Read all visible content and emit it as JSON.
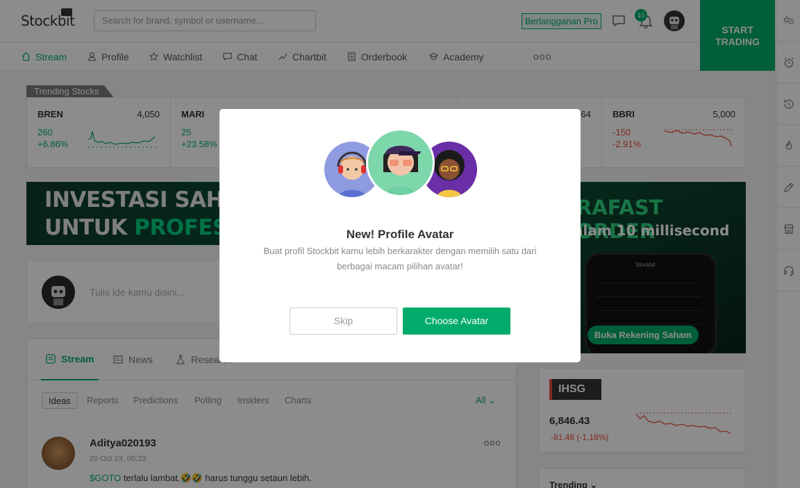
{
  "header": {
    "logo": "Stockbit",
    "search_placeholder": "Search for brand, symbol or username...",
    "pro_label": "Berlangganan Pro",
    "notification_count": "10",
    "start_trading_line1": "START",
    "start_trading_line2": "TRADING"
  },
  "nav": {
    "items": [
      {
        "label": "Stream",
        "icon": "home-icon"
      },
      {
        "label": "Profile",
        "icon": "person-icon"
      },
      {
        "label": "Watchlist",
        "icon": "star-icon"
      },
      {
        "label": "Chat",
        "icon": "chat-icon"
      },
      {
        "label": "Chartbit",
        "icon": "chart-icon"
      },
      {
        "label": "Orderbook",
        "icon": "orderbook-icon"
      },
      {
        "label": "Academy",
        "icon": "academy-icon"
      }
    ],
    "more": "ooo"
  },
  "trending": {
    "title": "Trending Stocks",
    "stocks": [
      {
        "symbol": "BREN",
        "price": "4,050",
        "change": "260",
        "percent": "+6.86%",
        "direction": "up"
      },
      {
        "symbol": "MARI",
        "price": "",
        "change": "25",
        "percent": "+23.58%",
        "direction": "up"
      },
      {
        "symbol": "",
        "price": "",
        "change": "",
        "percent": "",
        "direction": "up"
      },
      {
        "symbol": "",
        "price": "64",
        "change": "",
        "percent": "",
        "direction": "up"
      },
      {
        "symbol": "BBRI",
        "price": "5,000",
        "change": "-150",
        "percent": "-2.91%",
        "direction": "down"
      }
    ]
  },
  "banner": {
    "line1": "INVESTASI SAHA",
    "line2_a": "UNTUK ",
    "line2_b": "PROFESIO",
    "right_title": "RAFAST ORDER",
    "right_subtitle": "alam 10 millisecond",
    "phone_brand": "Stockbit",
    "cta": "Buka Rekening Saham"
  },
  "composer": {
    "placeholder": "Tulis ide kamu disini..."
  },
  "feed": {
    "tabs": [
      {
        "label": "Stream",
        "icon": "stream-icon"
      },
      {
        "label": "News",
        "icon": "news-icon"
      },
      {
        "label": "Research",
        "icon": "flask-icon"
      }
    ],
    "filters": [
      "Ideas",
      "Reports",
      "Predictions",
      "Polling",
      "Insiders",
      "Charts"
    ],
    "filter_all": "All",
    "post": {
      "user": "Aditya020193",
      "time": "20 Oct 23, 00:23",
      "ticker": "$GOTO",
      "text": " terlalu lambat.🤣🤣 harus tunggu setaun lebih.",
      "more": "ooo"
    }
  },
  "ihsg": {
    "label": "IHSG",
    "value": "6,846.43",
    "change": "-81.48 (-1.18%)"
  },
  "trending_card": {
    "title": "Trending"
  },
  "modal": {
    "title": "New! Profile Avatar",
    "description": "Buat profil Stockbit kamu lebih berkarakter dengan memilih satu dari berbagai macam pilihan avatar!",
    "skip": "Skip",
    "choose": "Choose Avatar"
  },
  "colors": {
    "accent": "#00ab6b",
    "down": "#e74c3c"
  }
}
